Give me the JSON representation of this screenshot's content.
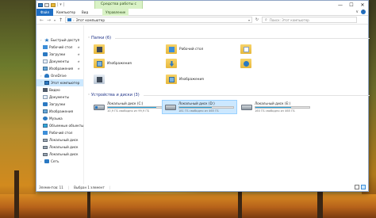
{
  "titlebar": {
    "title_prefix": "| ▾ |",
    "tools_tab": "Средства работы с дисками",
    "minimize": "—",
    "maximize": "☐",
    "close": "✕"
  },
  "ribbon": {
    "tabs": [
      "Файл",
      "Компьютер",
      "Вид",
      "Управление"
    ],
    "expand": "∨",
    "help": "?"
  },
  "address": {
    "back": "←",
    "forward": "→",
    "history": "▾",
    "up": "↑",
    "path": "Этот компьютер",
    "dropdown": "▾",
    "refresh": "↻",
    "search_placeholder": "Поиск: Этот компьютер",
    "search_icon": "⌕"
  },
  "sidebar": {
    "items": [
      {
        "label": "Быстрый доступ",
        "icon": "star-icon"
      },
      {
        "label": "Рабочий стол",
        "icon": "desktop-icon"
      },
      {
        "label": "Загрузки",
        "icon": "download-icon"
      },
      {
        "label": "Документы",
        "icon": "documents-icon"
      },
      {
        "label": "Изображения",
        "icon": "pictures-icon"
      },
      {
        "label": "OneDrive",
        "icon": "cloud-icon"
      },
      {
        "label": "Этот компьютер",
        "icon": "computer-icon"
      },
      {
        "label": "Видео",
        "icon": "video-icon"
      },
      {
        "label": "Документы",
        "icon": "documents-icon"
      },
      {
        "label": "Загрузки",
        "icon": "download-icon"
      },
      {
        "label": "Изображения",
        "icon": "pictures-icon"
      },
      {
        "label": "Музыка",
        "icon": "music-icon"
      },
      {
        "label": "Объемные объекты",
        "icon": "cube-icon"
      },
      {
        "label": "Рабочий стол",
        "icon": "desktop-icon"
      },
      {
        "label": "Локальный диск",
        "icon": "drive-icon"
      },
      {
        "label": "Локальный диск",
        "icon": "drive-icon"
      },
      {
        "label": "Локальный диск",
        "icon": "drive-icon"
      },
      {
        "label": "Сеть",
        "icon": "network-icon"
      }
    ],
    "pin": "★"
  },
  "folders": {
    "header": "Папки (6)",
    "items": [
      {
        "label": "",
        "icon": "video-folder-icon"
      },
      {
        "label": "Рабочий стол",
        "icon": "desktop-folder-icon"
      },
      {
        "label": "",
        "icon": "documents-folder-icon"
      },
      {
        "label": "Изображения",
        "icon": "pictures-folder-icon"
      },
      {
        "label": "",
        "icon": "downloads-folder-icon"
      },
      {
        "label": "",
        "icon": "music-folder-icon"
      },
      {
        "label": "",
        "icon": "3d-objects-folder-icon"
      },
      {
        "label": "Изображения",
        "icon": "pictures-folder-icon"
      }
    ]
  },
  "drives": {
    "header": "Устройства и диски (3)",
    "items": [
      {
        "name": "Локальный диск (C:)",
        "free": "10,9 ГБ свободно из 99,9 ГБ",
        "used_fraction": 0.89
      },
      {
        "name": "Локальный диск (D:)",
        "free": "181 ГБ свободно из 465 ГБ",
        "used_fraction": 0.61
      },
      {
        "name": "Локальный диск (E:)",
        "free": "160 ГБ свободно из 465 ГБ",
        "used_fraction": 0.66
      }
    ]
  },
  "status": {
    "items": "Элементов: 11",
    "selected": "Выбран 1 элемент"
  }
}
